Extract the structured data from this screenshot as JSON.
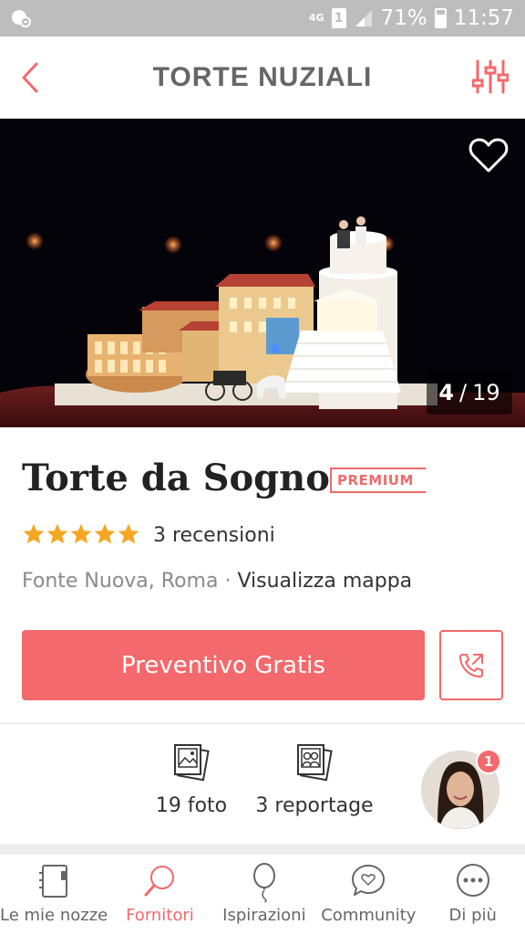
{
  "status_bar": {
    "network": "4G",
    "sim": "1",
    "battery": "71%",
    "time": "11:57"
  },
  "header": {
    "title": "TORTE NUZIALI"
  },
  "gallery": {
    "current": "4",
    "separator": "/",
    "total": "19"
  },
  "vendor": {
    "name": "Torte da Sogno",
    "badge": "PREMIUM",
    "rating": 5,
    "reviews": "3 recensioni",
    "location": "Fonte Nuova, Roma",
    "location_separator": "·",
    "map_link": "Visualizza mappa"
  },
  "actions": {
    "quote_button": "Preventivo Gratis"
  },
  "media": {
    "photos": "19 foto",
    "reportage": "3 reportage"
  },
  "assistant": {
    "notification_count": "1"
  },
  "bottom_nav": {
    "items": [
      {
        "label": "Le mie nozze",
        "icon": "notebook-icon"
      },
      {
        "label": "Fornitori",
        "icon": "search-icon",
        "active": true
      },
      {
        "label": "Ispirazioni",
        "icon": "balloon-icon"
      },
      {
        "label": "Community",
        "icon": "chat-heart-icon"
      },
      {
        "label": "Di più",
        "icon": "more-icon"
      }
    ]
  },
  "colors": {
    "accent": "#f4696b",
    "statusbar": "#bdbdbd",
    "star": "#f5a623"
  }
}
